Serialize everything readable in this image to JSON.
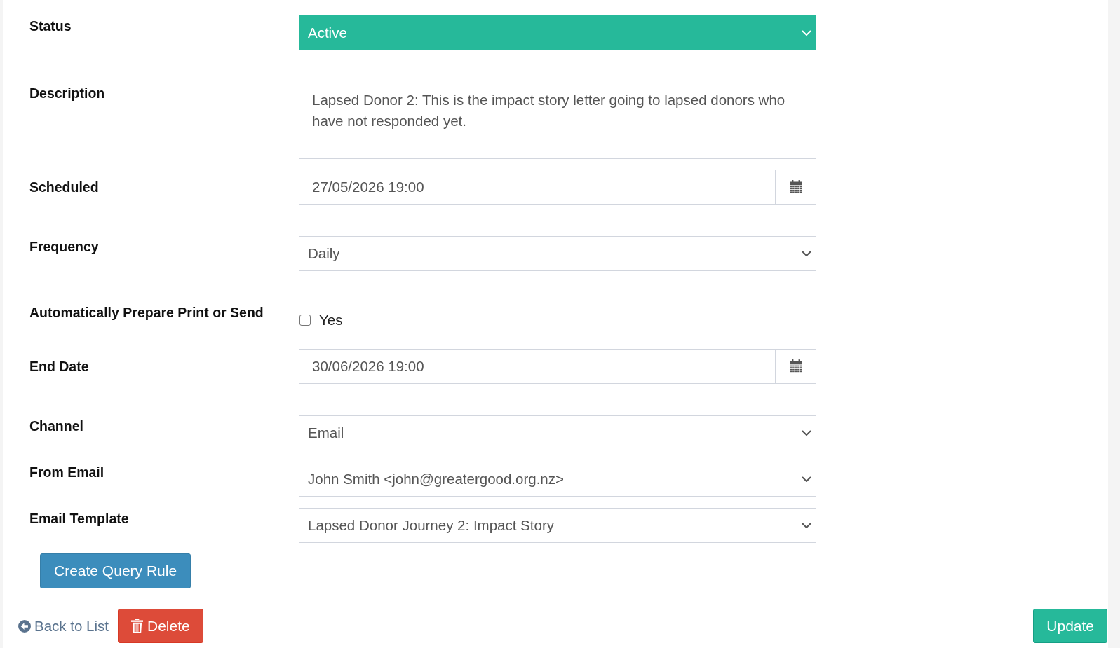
{
  "fields": [
    {
      "label": "Status",
      "kind": "select",
      "value": "Active",
      "color": "#26b99a"
    },
    {
      "label": "Description",
      "kind": "textarea",
      "value": "Lapsed Donor 2: This is the impact story letter going to lapsed donors who have not responded yet."
    },
    {
      "label": "Scheduled",
      "kind": "date",
      "value": "27/05/2026 19:00"
    },
    {
      "label": "Frequency",
      "kind": "select",
      "value": "Daily"
    },
    {
      "label": "Automatically Prepare Print or Send",
      "kind": "checkbox",
      "option": "Yes",
      "checked": false
    },
    {
      "label": "End Date",
      "kind": "date",
      "value": "30/06/2026 19:00"
    },
    {
      "label": "Channel",
      "kind": "select",
      "value": "Email"
    },
    {
      "label": "From Email",
      "kind": "select",
      "value": "John Smith <john@greatergood.org.nz>"
    },
    {
      "label": "Email Template",
      "kind": "select",
      "value": "Lapsed Donor Journey 2: Impact Story"
    }
  ],
  "query_button": "Create Query Rule",
  "footer": {
    "back_link": "Back to List",
    "delete_button": "Delete",
    "update_button": "Update"
  }
}
